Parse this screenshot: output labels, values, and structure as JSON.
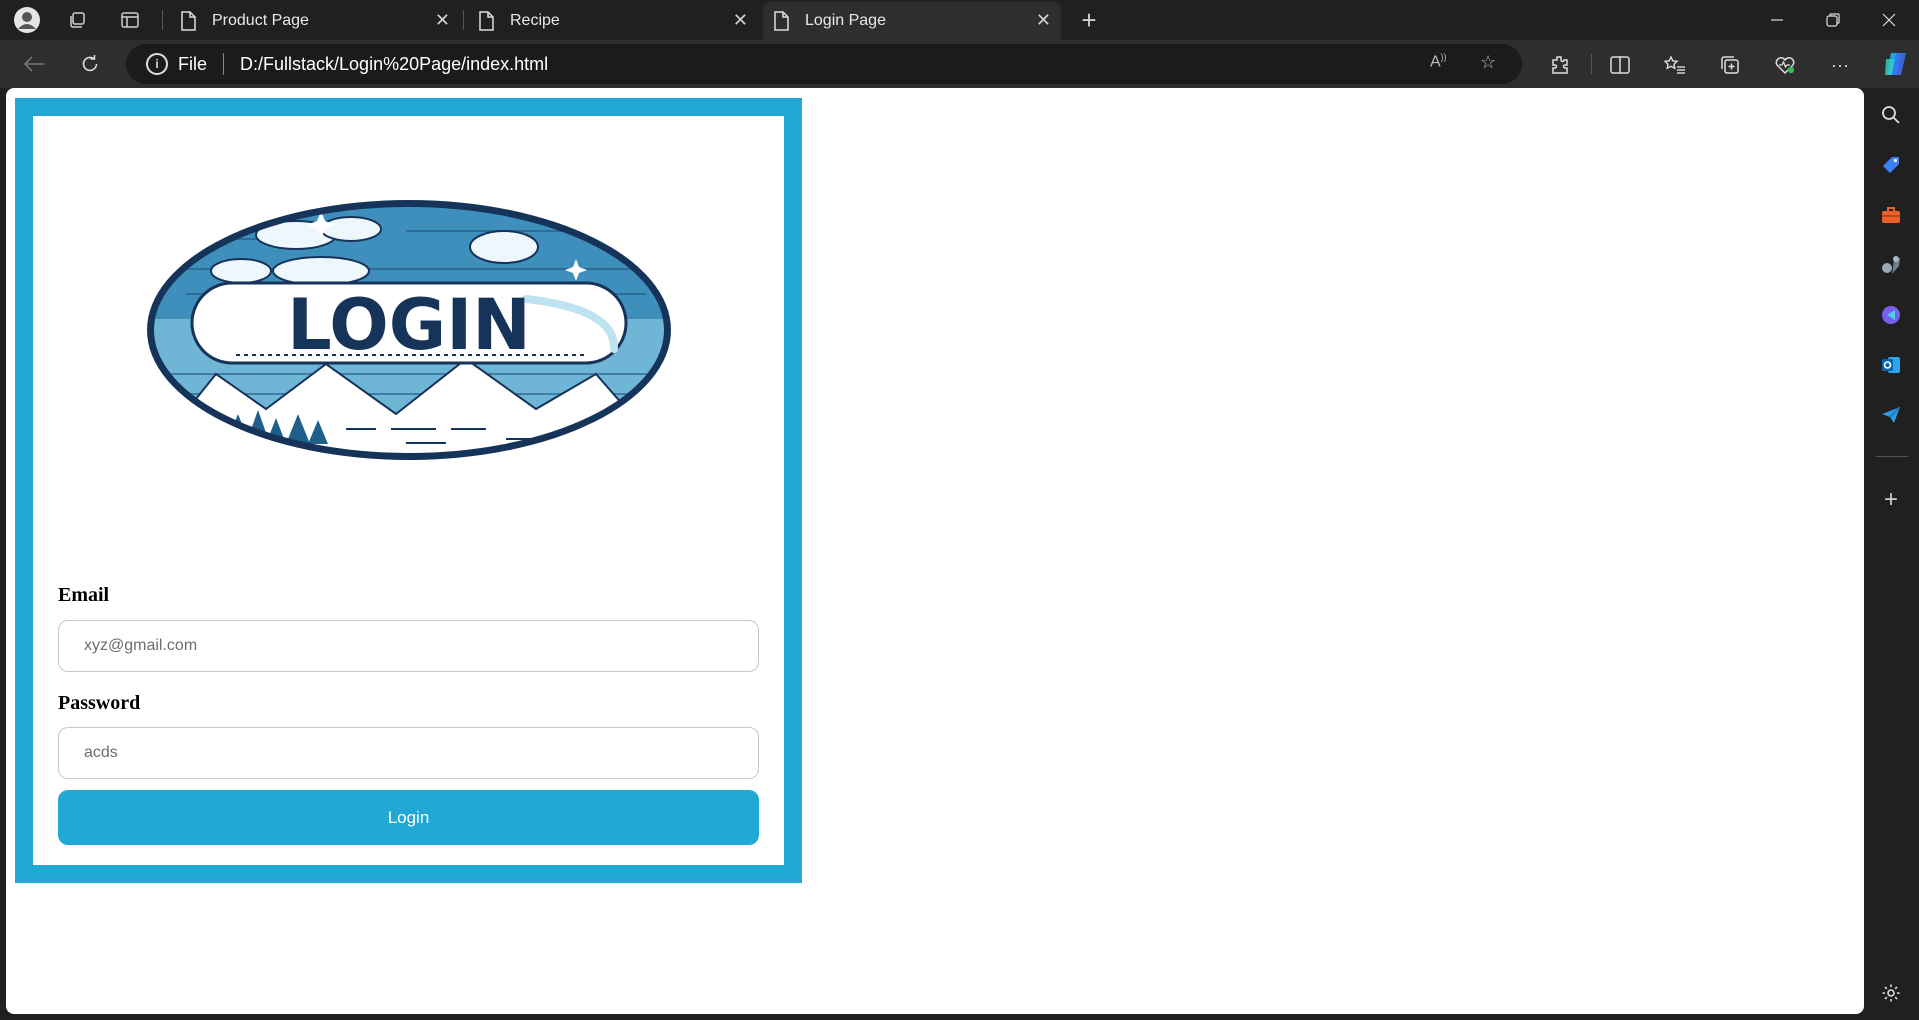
{
  "browser": {
    "tabs": [
      {
        "title": "Product Page",
        "active": false
      },
      {
        "title": "Recipe",
        "active": false
      },
      {
        "title": "Login Page",
        "active": true
      }
    ],
    "address": {
      "protocol_label": "File",
      "url": "D:/Fullstack/Login%20Page/index.html"
    }
  },
  "page": {
    "logo_text": "LOGIN",
    "email_label": "Email",
    "email_value": "xyz@gmail.com",
    "password_label": "Password",
    "password_value": "acds",
    "login_button": "Login"
  },
  "colors": {
    "accent": "#21a8d5",
    "logo_navy": "#16335a"
  }
}
